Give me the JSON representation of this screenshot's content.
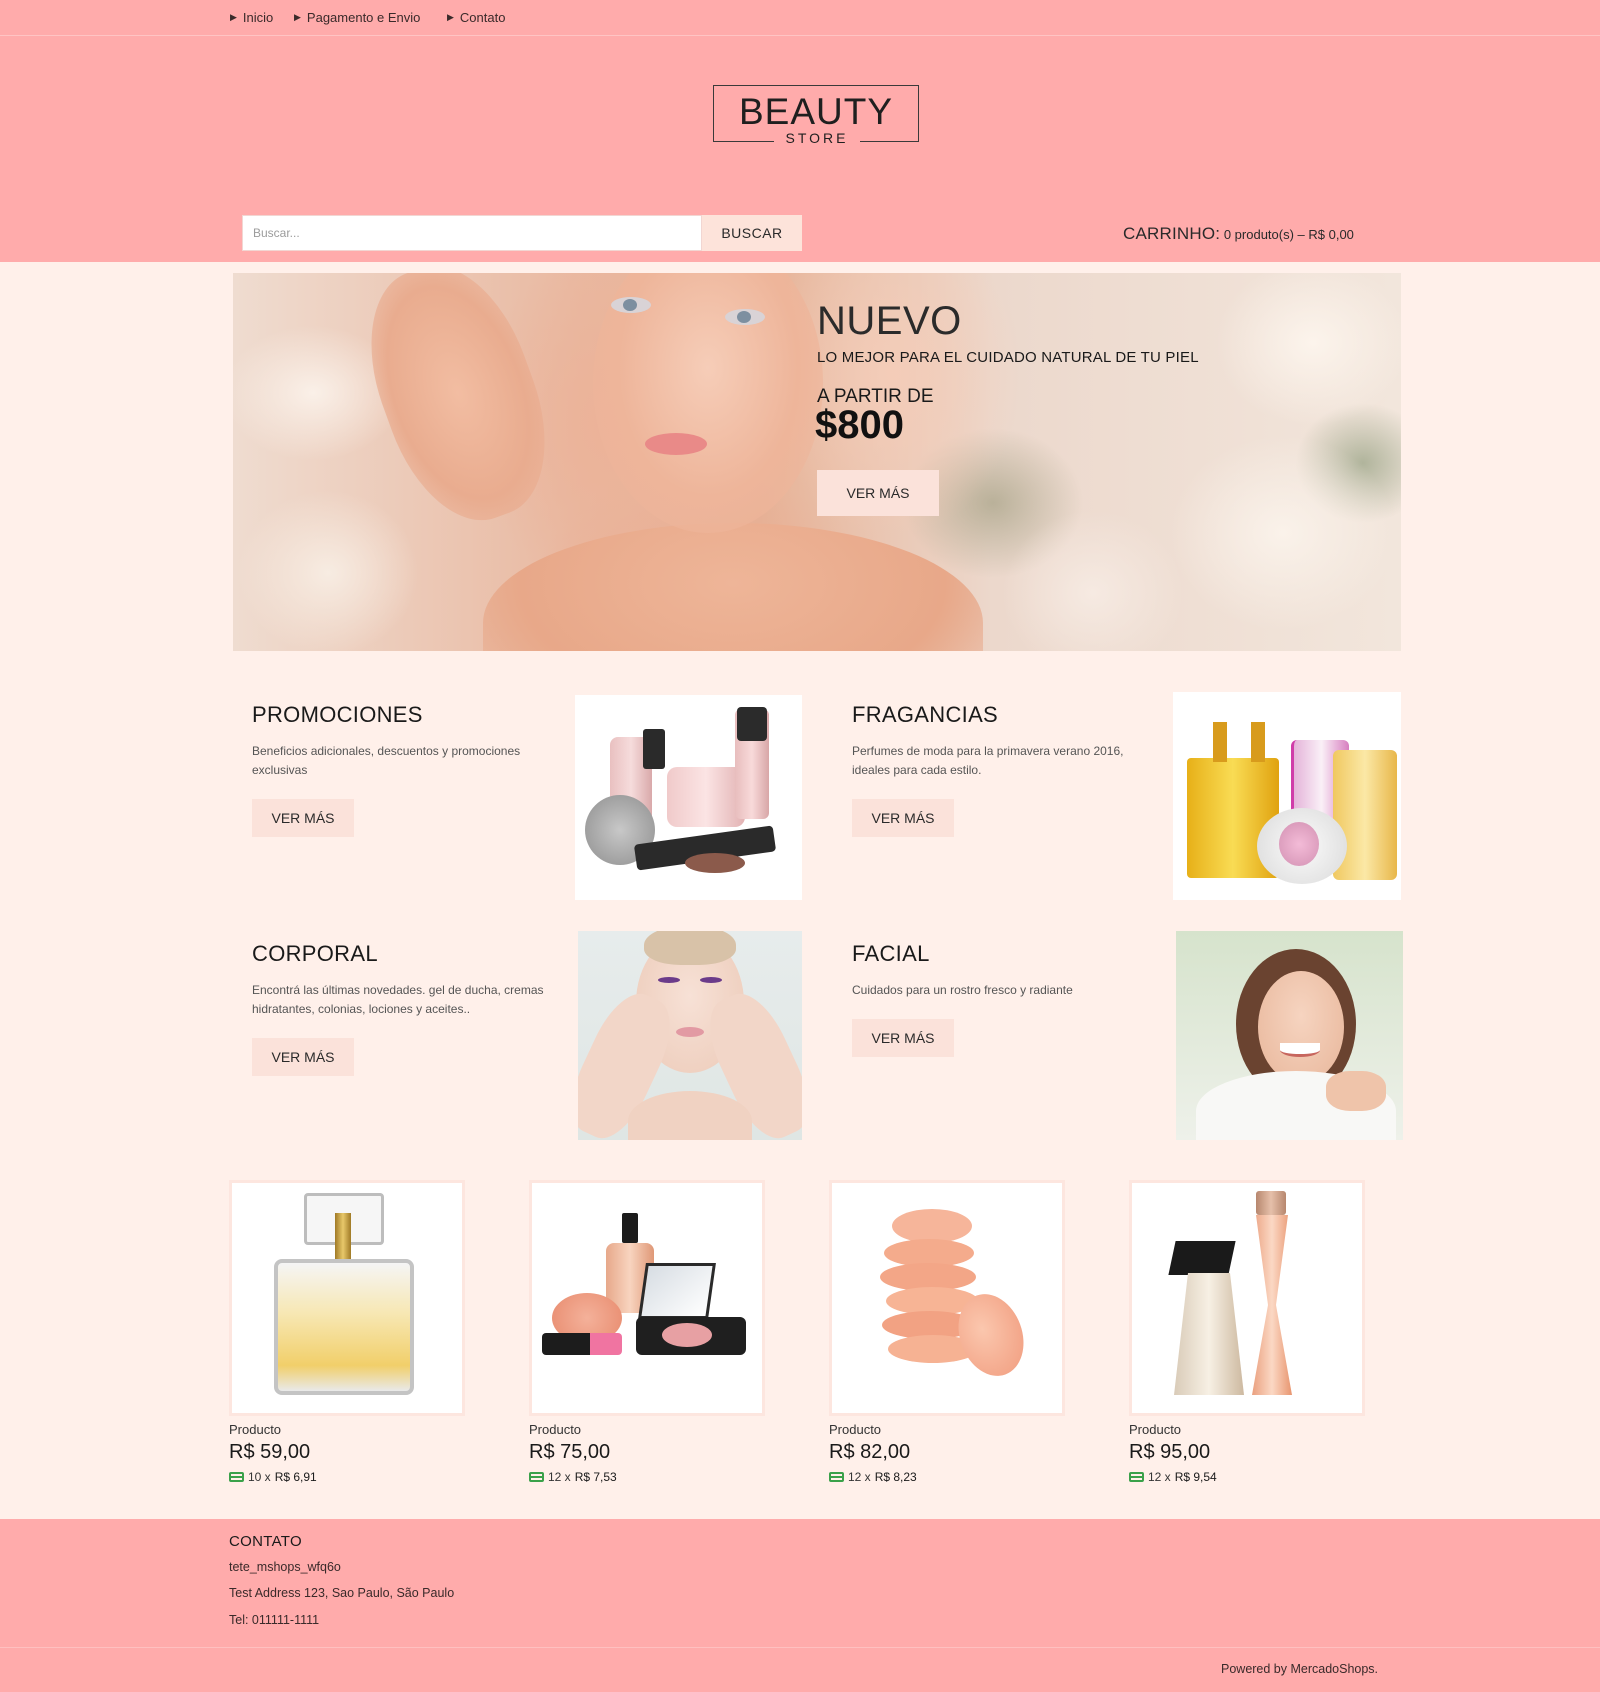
{
  "nav": {
    "items": [
      {
        "label": "Inicio"
      },
      {
        "label": "Pagamento e Envio"
      },
      {
        "label": "Contato"
      }
    ]
  },
  "header": {
    "logo_main": "BEAUTY",
    "logo_sub": "STORE",
    "search_placeholder": "Buscar...",
    "search_button": "BUSCAR",
    "cart_label": "CARRINHO:",
    "cart_summary": "0 produto(s) – R$ 0,00"
  },
  "hero": {
    "title": "NUEVO",
    "subtitle": "LO MEJOR PARA EL CUIDADO NATURAL DE TU PIEL",
    "from_label": "A PARTIR DE",
    "price": "$800",
    "button": "VER MÁS"
  },
  "categories": [
    {
      "title": "PROMOCIONES",
      "description": "Beneficios adicionales, descuentos y promociones exclusivas",
      "button": "VER MÁS"
    },
    {
      "title": "FRAGANCIAS",
      "description": "Perfumes de moda para la primavera verano 2016, ideales para cada estilo.",
      "button": "VER MÁS"
    },
    {
      "title": "CORPORAL",
      "description": "Encontrá las últimas novedades. gel de ducha, cremas hidratantes, colonias, lociones y aceites..",
      "button": "VER MÁS"
    },
    {
      "title": "FACIAL",
      "description": "Cuidados para un rostro fresco y radiante",
      "button": "VER MÁS"
    }
  ],
  "products": [
    {
      "name": "Producto",
      "price": "R$ 59,00",
      "installments": "10 x",
      "installment_value": "R$ 6,91"
    },
    {
      "name": "Producto",
      "price": "R$ 75,00",
      "installments": "12 x",
      "installment_value": "R$ 7,53"
    },
    {
      "name": "Producto",
      "price": "R$ 82,00",
      "installments": "12 x",
      "installment_value": "R$ 8,23"
    },
    {
      "name": "Producto",
      "price": "R$ 95,00",
      "installments": "12 x",
      "installment_value": "R$ 9,54"
    }
  ],
  "footer": {
    "title": "CONTATO",
    "store_name": "tete_mshops_wfq6o",
    "address": "Test Address 123, Sao Paulo, São Paulo",
    "phone": "Tel: 011111-1111",
    "powered": "Powered by MercadoShops."
  },
  "colors": {
    "header_bg": "#ffabab",
    "page_bg": "#fff0ea",
    "button_bg": "#fbe2da",
    "card_icon": "#3aa14a"
  }
}
